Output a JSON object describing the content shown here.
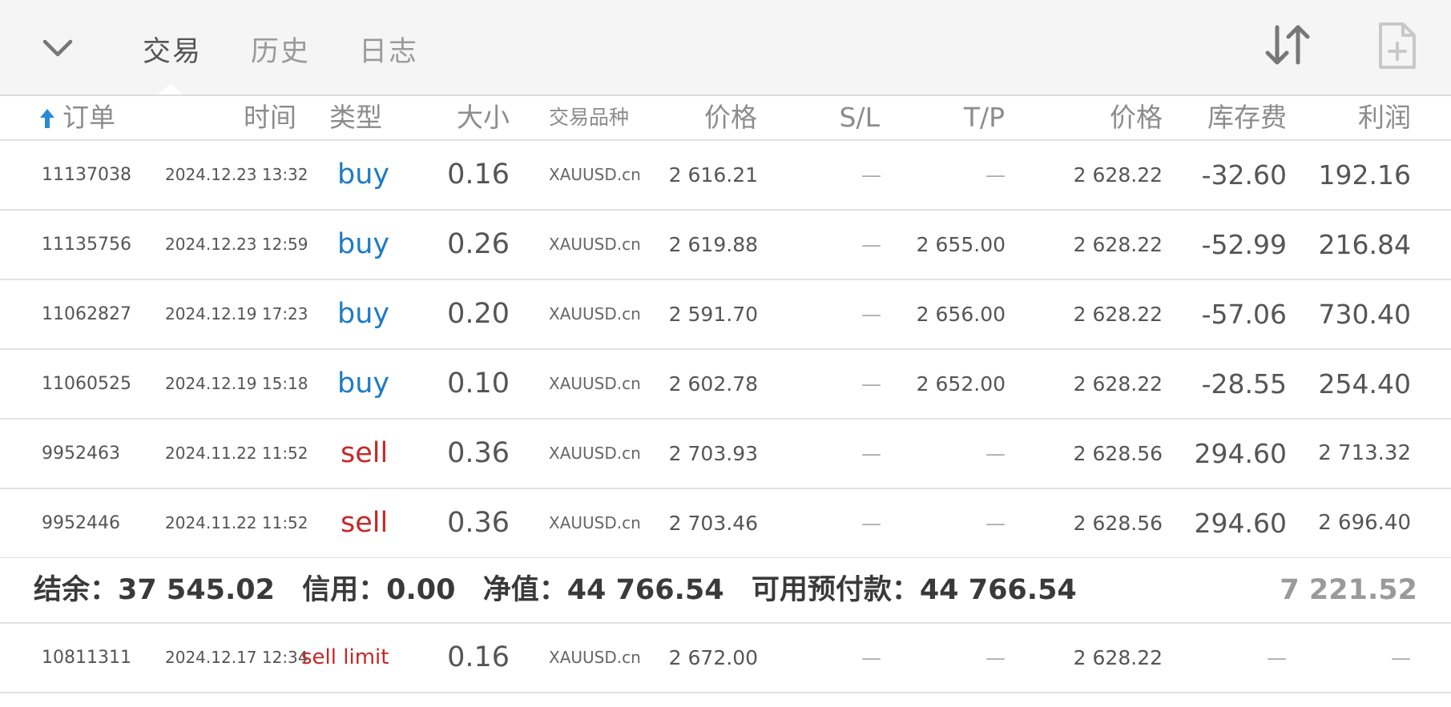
{
  "tabs": [
    {
      "label": "交易",
      "active": true
    },
    {
      "label": "历史",
      "active": false
    },
    {
      "label": "日志",
      "active": false
    }
  ],
  "icons": {
    "collapse": "chevron-down-icon",
    "sort": "sort-arrows-icon",
    "new_order": "add-document-icon",
    "header_sort": "arrow-up-icon"
  },
  "colors": {
    "buy": "#1f7bc4",
    "sell": "#c62828"
  },
  "columns": {
    "ticket": "订单",
    "time": "时间",
    "type": "类型",
    "size": "大小",
    "symbol": "交易品种",
    "price": "价格",
    "sl": "S/L",
    "tp": "T/P",
    "current_price": "价格",
    "swap": "库存费",
    "profit": "利润"
  },
  "positions": [
    {
      "ticket": "11137038",
      "time": "2024.12.23 13:32",
      "type": "buy",
      "size": "0.16",
      "symbol": "XAUUSD.cn",
      "price": "2 616.21",
      "sl": "—",
      "tp": "—",
      "current_price": "2 628.22",
      "swap": "-32.60",
      "profit": "192.16"
    },
    {
      "ticket": "11135756",
      "time": "2024.12.23 12:59",
      "type": "buy",
      "size": "0.26",
      "symbol": "XAUUSD.cn",
      "price": "2 619.88",
      "sl": "—",
      "tp": "2 655.00",
      "current_price": "2 628.22",
      "swap": "-52.99",
      "profit": "216.84"
    },
    {
      "ticket": "11062827",
      "time": "2024.12.19 17:23",
      "type": "buy",
      "size": "0.20",
      "symbol": "XAUUSD.cn",
      "price": "2 591.70",
      "sl": "—",
      "tp": "2 656.00",
      "current_price": "2 628.22",
      "swap": "-57.06",
      "profit": "730.40"
    },
    {
      "ticket": "11060525",
      "time": "2024.12.19 15:18",
      "type": "buy",
      "size": "0.10",
      "symbol": "XAUUSD.cn",
      "price": "2 602.78",
      "sl": "—",
      "tp": "2 652.00",
      "current_price": "2 628.22",
      "swap": "-28.55",
      "profit": "254.40"
    },
    {
      "ticket": "9952463",
      "time": "2024.11.22 11:52",
      "type": "sell",
      "size": "0.36",
      "symbol": "XAUUSD.cn",
      "price": "2 703.93",
      "sl": "—",
      "tp": "—",
      "current_price": "2 628.56",
      "swap": "294.60",
      "profit": "2 713.32"
    },
    {
      "ticket": "9952446",
      "time": "2024.11.22 11:52",
      "type": "sell",
      "size": "0.36",
      "symbol": "XAUUSD.cn",
      "price": "2 703.46",
      "sl": "—",
      "tp": "—",
      "current_price": "2 628.56",
      "swap": "294.60",
      "profit": "2 696.40"
    }
  ],
  "summary": {
    "balance": "结余：37 545.02",
    "credit": "信用：0.00",
    "equity": "净值：44 766.54",
    "free_margin": "可用预付款：44 766.54",
    "total_profit": "7 221.52"
  },
  "pending": [
    {
      "ticket": "10811311",
      "time": "2024.12.17 12:34",
      "type": "sell limit",
      "size": "0.16",
      "symbol": "XAUUSD.cn",
      "price": "2 672.00",
      "sl": "—",
      "tp": "—",
      "current_price": "2 628.22",
      "swap": "—",
      "profit": "—"
    }
  ]
}
